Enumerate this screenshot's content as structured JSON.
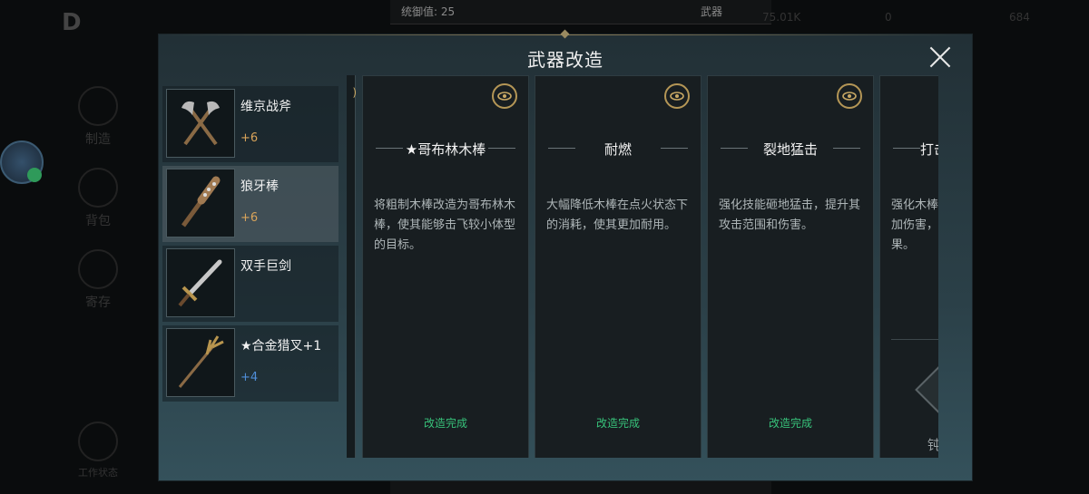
{
  "background": {
    "top_stat_label": "统御值: 25",
    "top_category": "武器",
    "resource_1": "75.01K",
    "resource_2": "0",
    "resource_3": "684",
    "side_nav": [
      {
        "label": "制造"
      },
      {
        "label": "背包"
      },
      {
        "label": "寄存"
      },
      {
        "label": "工作状态"
      }
    ]
  },
  "modal": {
    "title": "武器改造",
    "weapons": [
      {
        "name": "维京战斧",
        "level": "+6",
        "icon": "battle-axe-icon"
      },
      {
        "name": "狼牙棒",
        "level": "+6",
        "icon": "spiked-club-icon"
      },
      {
        "name": "双手巨剑",
        "level": "",
        "icon": "greatsword-icon"
      },
      {
        "name": "★合金猎叉+1",
        "level": "+4",
        "icon": "trident-icon"
      }
    ],
    "mods": [
      {
        "title": "★哥布林木棒",
        "description": "将粗制木棒改造为哥布林木棒，使其能够击飞较小体型的目标。",
        "status": "改造完成"
      },
      {
        "title": "耐燃",
        "description": "大幅降低木棒在点火状态下的消耗，使其更加耐用。",
        "status": "改造完成"
      },
      {
        "title": "裂地猛击",
        "description": "强化技能砸地猛击，提升其攻击范围和伤害。",
        "status": "改造完成"
      },
      {
        "title": "打击",
        "description": "强化木棒\n加伤害，\n果。",
        "status": "",
        "bottom_text": "钝"
      }
    ]
  },
  "colors": {
    "accent_gold": "#b49656",
    "status_green": "#37c27a",
    "level_orange": "#d9a45a",
    "level_blue": "#4f8ed8"
  }
}
